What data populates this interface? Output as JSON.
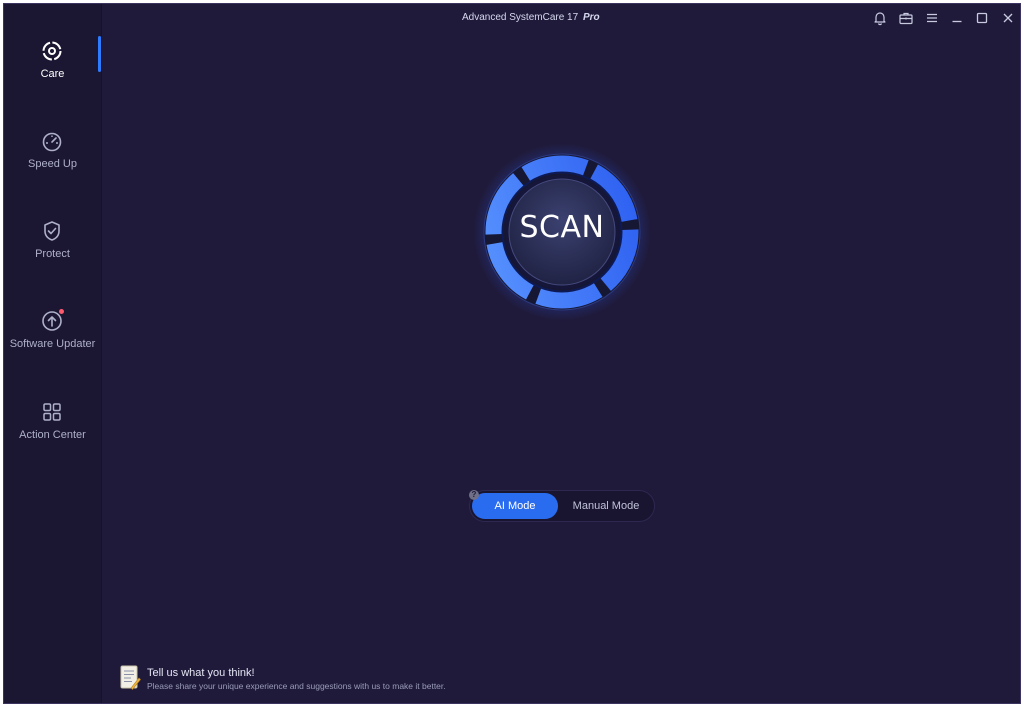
{
  "window": {
    "title": "Advanced SystemCare 17",
    "edition": "Pro"
  },
  "titlebar_icons": [
    "bell-icon",
    "toolbox-icon",
    "menu-icon",
    "minimize-icon",
    "maximize-icon",
    "close-icon"
  ],
  "sidebar": {
    "items": [
      {
        "label": "Care",
        "icon": "care-icon",
        "active": true
      },
      {
        "label": "Speed Up",
        "icon": "speedometer-icon"
      },
      {
        "label": "Protect",
        "icon": "shield-icon"
      },
      {
        "label": "Software Updater",
        "icon": "upload-cloud-icon",
        "badge": true
      },
      {
        "label": "Action Center",
        "icon": "grid-icon"
      }
    ]
  },
  "main": {
    "scan_label": "SCAN",
    "modes": {
      "ai": "AI Mode",
      "manual": "Manual Mode",
      "help": "?"
    },
    "feedback": {
      "title": "Tell us what you think!",
      "subtitle": "Please share your unique experience and suggestions with us to make it better."
    }
  },
  "colors": {
    "background": "#1f1a3a",
    "sidebar": "#1b1733",
    "accent": "#2d7bff",
    "ring": "#3a78ff"
  }
}
